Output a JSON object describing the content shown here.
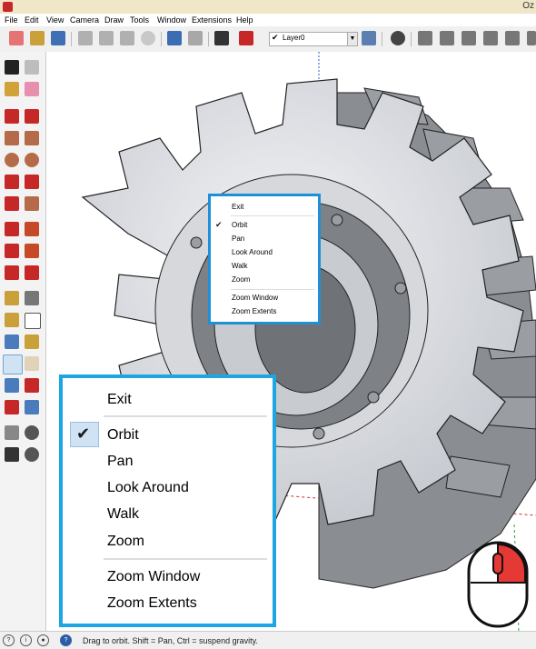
{
  "window": {
    "title": "Oz"
  },
  "menu": [
    "File",
    "Edit",
    "View",
    "Camera",
    "Draw",
    "Tools",
    "Window",
    "Extensions",
    "Help"
  ],
  "toolbar": {
    "layer": "Layer0"
  },
  "context_menu_small": {
    "exit": "Exit",
    "orbit": "Orbit",
    "pan": "Pan",
    "look_around": "Look Around",
    "walk": "Walk",
    "zoom": "Zoom",
    "zoom_window": "Zoom Window",
    "zoom_extents": "Zoom Extents",
    "checked": "Orbit"
  },
  "context_menu_large": {
    "exit": "Exit",
    "orbit": "Orbit",
    "pan": "Pan",
    "look_around": "Look Around",
    "walk": "Walk",
    "zoom": "Zoom",
    "zoom_window": "Zoom Window",
    "zoom_extents": "Zoom Extents",
    "checked": "Orbit"
  },
  "status": {
    "text": "Drag to orbit. Shift = Pan, Ctrl = suspend gravity."
  },
  "icons": {
    "mouse": "mouse-right-button-icon",
    "accent": "#1ea6e4"
  }
}
